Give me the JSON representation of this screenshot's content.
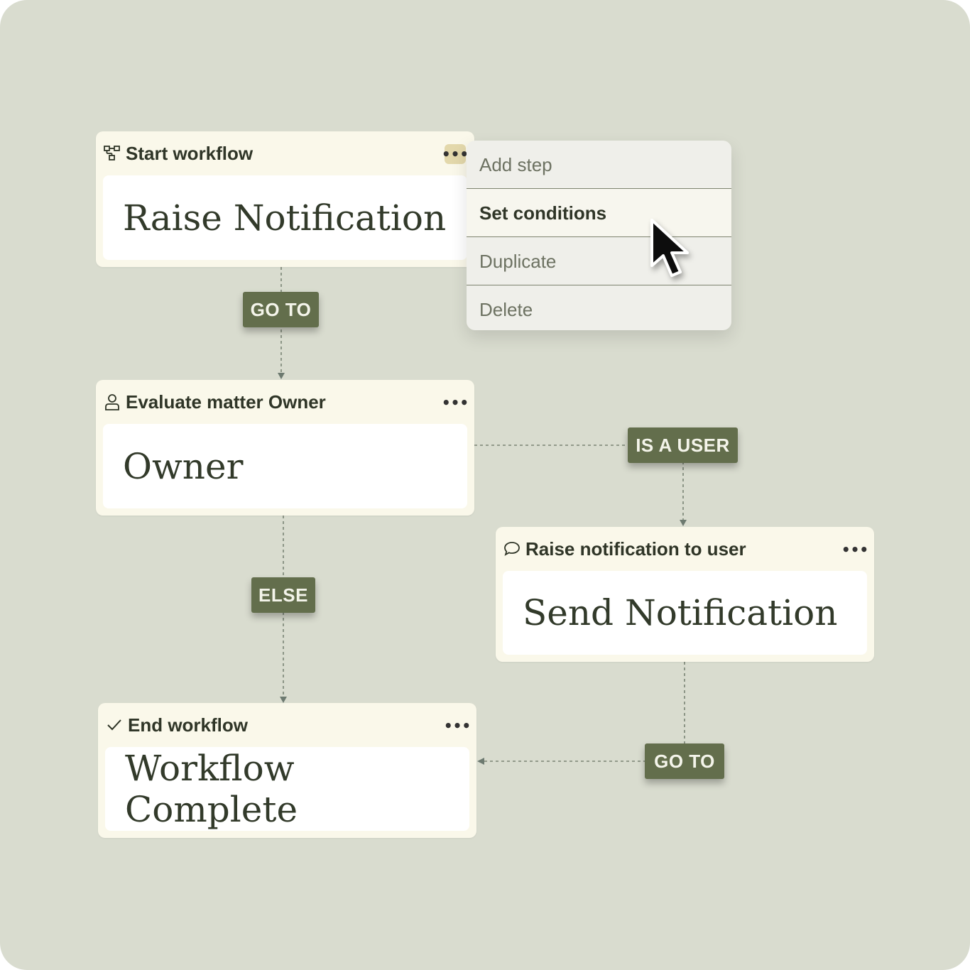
{
  "nodes": {
    "start": {
      "title": "Start workflow",
      "body": "Raise Notification",
      "icon": "workflow-icon",
      "more": "•••"
    },
    "evaluate": {
      "title": "Evaluate matter Owner",
      "body": "Owner",
      "icon": "user-icon",
      "more": "•••"
    },
    "notify": {
      "title": "Raise notification to user",
      "body": "Send Notification",
      "icon": "chat-bubble-icon",
      "more": "•••"
    },
    "end": {
      "title": "End workflow",
      "body": "Workflow Complete",
      "icon": "checkmark-icon",
      "more": "•••"
    }
  },
  "connectors": {
    "goto_1": "GO TO",
    "is_user": "IS A USER",
    "else": "ELSE",
    "goto_2": "GO TO"
  },
  "context_menu": {
    "items": [
      "Add step",
      "Set conditions",
      "Duplicate",
      "Delete"
    ],
    "selected": "Set conditions"
  },
  "colors": {
    "canvas": "#d9dccf",
    "card": "#faf8ea",
    "tag": "#636e4c",
    "text": "#2f3527",
    "wire": "#7a8475"
  }
}
